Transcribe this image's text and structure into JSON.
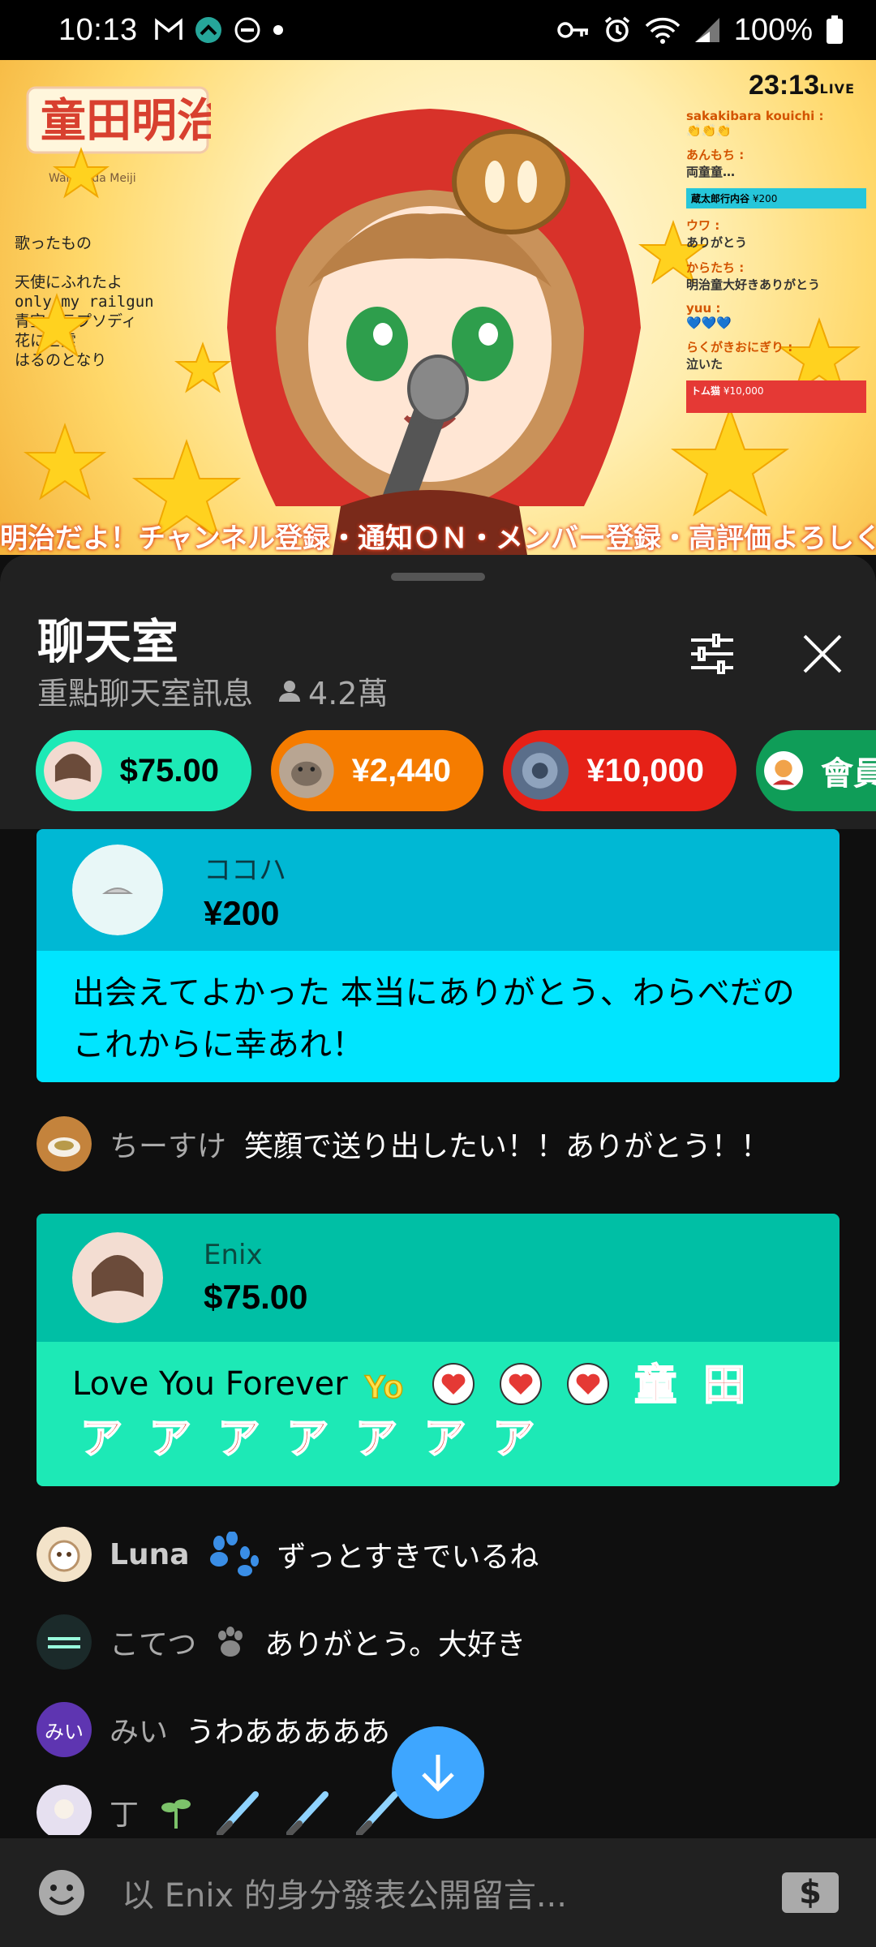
{
  "status_bar": {
    "time": "10:13",
    "battery": "100%",
    "icons": [
      "gmail-icon",
      "app-icon",
      "dnd-icon",
      "dot-icon",
      "key-icon",
      "alarm-icon",
      "wifi-icon",
      "signal-icon",
      "battery-icon"
    ]
  },
  "video": {
    "logo_text": "童田明治",
    "logo_sub": "Warabeda Meiji",
    "songs_title": "歌ったもの",
    "songs": [
      "天使にふれたよ",
      "only my railgun",
      "青空のラプソディ",
      "花に亡霊",
      "はるのとなり"
    ],
    "clock": "23:13",
    "live": "LIVE",
    "ticker": "明治だよ！チャンネル登録・通知ＯＮ・メンバー登録・高評価よろしく",
    "mini_chat": [
      {
        "name": "sakakibara kouichi :",
        "text": "👏👏👏"
      },
      {
        "name": "あんもち :",
        "text": "両童童…"
      },
      {
        "name": "ウワ :",
        "text": "ありがとう"
      },
      {
        "name": "からたち :",
        "text": "明治童大好きありがとう"
      },
      {
        "name": "yuu :",
        "text": "💙💙💙"
      },
      {
        "name": "らくがきおにぎり :",
        "text": "泣いた"
      }
    ],
    "mini_super": {
      "name": "蔵太郎行内谷",
      "amount": "¥200"
    },
    "mini_red": {
      "name": "トム猫",
      "amount": "¥10,000"
    }
  },
  "panel": {
    "title": "聊天室",
    "subtitle": "重點聊天室訊息",
    "viewers": "4.2萬",
    "chips": [
      {
        "amount": "$75.00",
        "color": "#1de9b6"
      },
      {
        "amount": "¥2,440",
        "color": "#f57c00"
      },
      {
        "amount": "¥10,000",
        "color": "#e62117"
      },
      {
        "amount": "會員",
        "color": "#0f9d58"
      }
    ]
  },
  "chat": {
    "super1": {
      "name": "ココハ",
      "amount": "¥200",
      "message": "出会えてよかった 本当にありがとう、わらべだのこれからに幸あれ！"
    },
    "msg1": {
      "author": "ちーすけ",
      "text": "笑顔で送り出したい！！ありがとう！！"
    },
    "super2": {
      "name": "Enix",
      "amount": "$75.00",
      "message": "Love You Forever",
      "kanji": [
        "童",
        "田"
      ],
      "a_char": "ア"
    },
    "msg2": {
      "author": "Luna",
      "text": "ずっとすきでいるね"
    },
    "msg3": {
      "author": "こてつ",
      "text": "ありがとう。大好き"
    },
    "msg4": {
      "author": "みい",
      "avatar_text": "みい",
      "text": "うわあああああ"
    },
    "msg5": {
      "author": "丁",
      "text": ""
    }
  },
  "input": {
    "placeholder": "以 Enix 的身分發表公開留言...",
    "money_label": "$"
  }
}
